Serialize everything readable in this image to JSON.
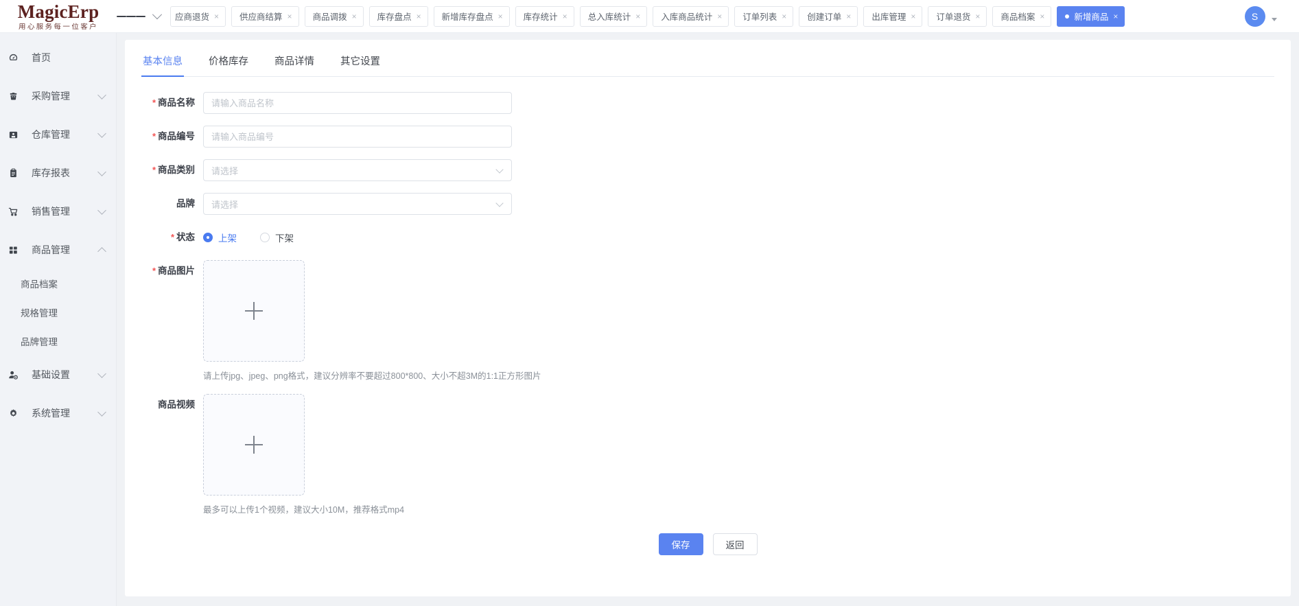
{
  "brand": {
    "name": "MagicErp",
    "slogan": "用心服务每一位客户",
    "logo_color": "#5d2220",
    "accent_color": "#5a83f0"
  },
  "topbar": {
    "menu_icon": "hamburger-icon",
    "collapse_icon": "chevron-down-icon",
    "tabs": [
      {
        "label": "应商退货",
        "closable": true,
        "active": false
      },
      {
        "label": "供应商结算",
        "closable": true,
        "active": false
      },
      {
        "label": "商品调拨",
        "closable": true,
        "active": false
      },
      {
        "label": "库存盘点",
        "closable": true,
        "active": false
      },
      {
        "label": "新增库存盘点",
        "closable": true,
        "active": false
      },
      {
        "label": "库存统计",
        "closable": true,
        "active": false
      },
      {
        "label": "总入库统计",
        "closable": true,
        "active": false
      },
      {
        "label": "入库商品统计",
        "closable": true,
        "active": false
      },
      {
        "label": "订单列表",
        "closable": true,
        "active": false
      },
      {
        "label": "创建订单",
        "closable": true,
        "active": false
      },
      {
        "label": "出库管理",
        "closable": true,
        "active": false
      },
      {
        "label": "订单退货",
        "closable": true,
        "active": false
      },
      {
        "label": "商品档案",
        "closable": true,
        "active": false
      },
      {
        "label": "新增商品",
        "closable": true,
        "active": true
      }
    ],
    "close_glyph": "×",
    "avatar_initial": "S"
  },
  "sidebar": {
    "items": [
      {
        "label": "首页",
        "icon": "dashboard-icon",
        "expandable": false
      },
      {
        "label": "采购管理",
        "icon": "purchase-cart-icon",
        "expandable": true,
        "expanded": false
      },
      {
        "label": "仓库管理",
        "icon": "warehouse-icon",
        "expandable": true,
        "expanded": false
      },
      {
        "label": "库存报表",
        "icon": "clipboard-icon",
        "expandable": true,
        "expanded": false
      },
      {
        "label": "销售管理",
        "icon": "shopping-cart-icon",
        "expandable": true,
        "expanded": false
      },
      {
        "label": "商品管理",
        "icon": "grid-icon",
        "expandable": true,
        "expanded": true
      },
      {
        "label": "基础设置",
        "icon": "user-gear-icon",
        "expandable": true,
        "expanded": false
      },
      {
        "label": "系统管理",
        "icon": "gear-icon",
        "expandable": true,
        "expanded": false
      }
    ],
    "product_sub_items": [
      {
        "label": "商品档案"
      },
      {
        "label": "规格管理"
      },
      {
        "label": "品牌管理"
      }
    ]
  },
  "form_tabs": [
    {
      "label": "基本信息",
      "active": true
    },
    {
      "label": "价格库存",
      "active": false
    },
    {
      "label": "商品详情",
      "active": false
    },
    {
      "label": "其它设置",
      "active": false
    }
  ],
  "form": {
    "product_name": {
      "label": "商品名称",
      "required": true,
      "value": "",
      "placeholder": "请输入商品名称"
    },
    "product_code": {
      "label": "商品编号",
      "required": true,
      "value": "",
      "placeholder": "请输入商品编号"
    },
    "category": {
      "label": "商品类别",
      "required": true,
      "value": "请选择"
    },
    "brand": {
      "label": "品牌",
      "required": false,
      "value": "请选择"
    },
    "status": {
      "label": "状态",
      "required": true,
      "options": [
        {
          "label": "上架",
          "selected": true
        },
        {
          "label": "下架",
          "selected": false
        }
      ]
    },
    "image": {
      "label": "商品图片",
      "required": true,
      "upload_glyph": "+",
      "hint": "请上传jpg、jpeg、png格式，建议分辨率不要超过800*800、大小不超3M的1:1正方形图片"
    },
    "video": {
      "label": "商品视频",
      "required": false,
      "upload_glyph": "+",
      "hint": "最多可以上传1个视频，建议大小10M，推荐格式mp4"
    }
  },
  "actions": {
    "save_label": "保存",
    "back_label": "返回"
  }
}
